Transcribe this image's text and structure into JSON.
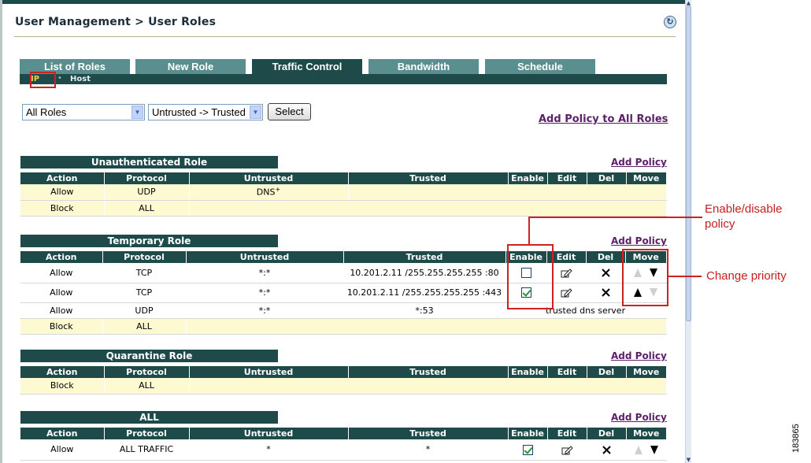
{
  "header": {
    "breadcrumb": "User Management > User Roles",
    "help_icon": "help-refresh-icon"
  },
  "tabs": [
    {
      "label": "List of Roles",
      "active": false
    },
    {
      "label": "New Role",
      "active": false
    },
    {
      "label": "Traffic Control",
      "active": true
    },
    {
      "label": "Bandwidth",
      "active": false
    },
    {
      "label": "Schedule",
      "active": false
    }
  ],
  "subtabs": {
    "ip": "IP",
    "host": "Host"
  },
  "filters": {
    "role_select": "All Roles",
    "direction_select": "Untrusted -> Trusted",
    "select_button": "Select",
    "add_policy_all": "Add Policy to All Roles"
  },
  "columns": {
    "action": "Action",
    "protocol": "Protocol",
    "untrusted": "Untrusted",
    "trusted": "Trusted",
    "enable": "Enable",
    "edit": "Edit",
    "del": "Del",
    "move": "Move"
  },
  "add_policy_label": "Add Policy",
  "sections": {
    "unauth": {
      "title": "Unauthenticated Role",
      "rows": [
        {
          "action": "Allow",
          "protocol": "UDP",
          "untrusted": "DNS",
          "untrusted_sup": "+",
          "trusted": ""
        },
        {
          "action": "Block",
          "protocol": "ALL",
          "untrusted": "",
          "trusted": ""
        }
      ]
    },
    "temp": {
      "title": "Temporary Role",
      "rows": [
        {
          "action": "Allow",
          "protocol": "TCP",
          "untrusted": "*:*",
          "trusted": "10.201.2.11 /255.255.255.255 :80",
          "enabled": false
        },
        {
          "action": "Allow",
          "protocol": "TCP",
          "untrusted": "*:*",
          "trusted": "10.201.2.11 /255.255.255.255 :443",
          "enabled": true
        },
        {
          "action": "Allow",
          "protocol": "UDP",
          "untrusted": "*:*",
          "trusted": "*:53",
          "description": "trusted dns server"
        },
        {
          "action": "Block",
          "protocol": "ALL",
          "untrusted": "",
          "trusted": ""
        }
      ]
    },
    "quar": {
      "title": "Quarantine Role",
      "rows": [
        {
          "action": "Block",
          "protocol": "ALL",
          "untrusted": "",
          "trusted": ""
        }
      ]
    },
    "all": {
      "title": "ALL",
      "rows": [
        {
          "action": "Allow",
          "protocol": "ALL TRAFFIC",
          "untrusted": "*",
          "trusted": "*",
          "enabled": true
        }
      ]
    }
  },
  "callouts": {
    "enable": "Enable/disable\npolicy",
    "enable_line1": "Enable/disable",
    "enable_line2": "policy",
    "priority": "Change priority"
  },
  "figure_id": "183865",
  "colors": {
    "header_dark": "#1e4a4a",
    "tab": "#5b8e8e",
    "row_yellow": "#fdf9d0",
    "link": "#5d1e6a",
    "callout": "#cc2222"
  }
}
